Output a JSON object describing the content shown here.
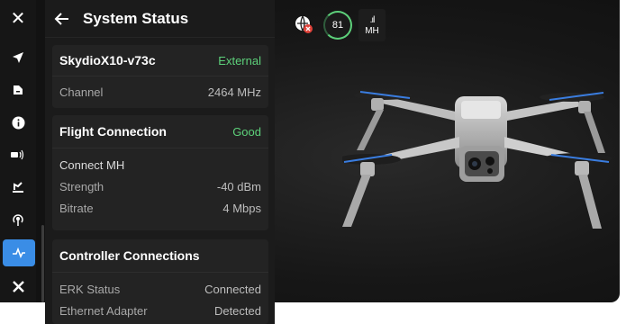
{
  "header": {
    "title": "System Status"
  },
  "rail": {
    "items": [
      {
        "icon": "close-icon"
      },
      {
        "icon": "navigation-arrow-icon"
      },
      {
        "icon": "file-icon"
      },
      {
        "icon": "info-icon"
      },
      {
        "icon": "camera-signal-icon"
      },
      {
        "icon": "landing-icon"
      },
      {
        "icon": "wireless-icon"
      },
      {
        "icon": "pulse-icon",
        "active": true
      },
      {
        "icon": "tools-icon"
      }
    ]
  },
  "cards": {
    "aircraft": {
      "name": "SkydioX10-v73c",
      "status": "External",
      "rows": [
        {
          "label": "Channel",
          "value": "2464 MHz"
        }
      ]
    },
    "flight": {
      "title": "Flight Connection",
      "status": "Good",
      "rows": [
        {
          "label": "Connect MH",
          "value": ""
        },
        {
          "label": "Strength",
          "value": "-40 dBm"
        },
        {
          "label": "Bitrate",
          "value": "4 Mbps"
        }
      ]
    },
    "controller": {
      "title": "Controller Connections",
      "rows": [
        {
          "label": "ERK Status",
          "value": "Connected"
        },
        {
          "label": "Ethernet Adapter",
          "value": "Detected"
        }
      ]
    }
  },
  "overlay": {
    "battery": "81",
    "signal_label": "MH"
  },
  "colors": {
    "accent": "#3a8de6",
    "good": "#5dd07a",
    "warning": "#e0423a"
  }
}
